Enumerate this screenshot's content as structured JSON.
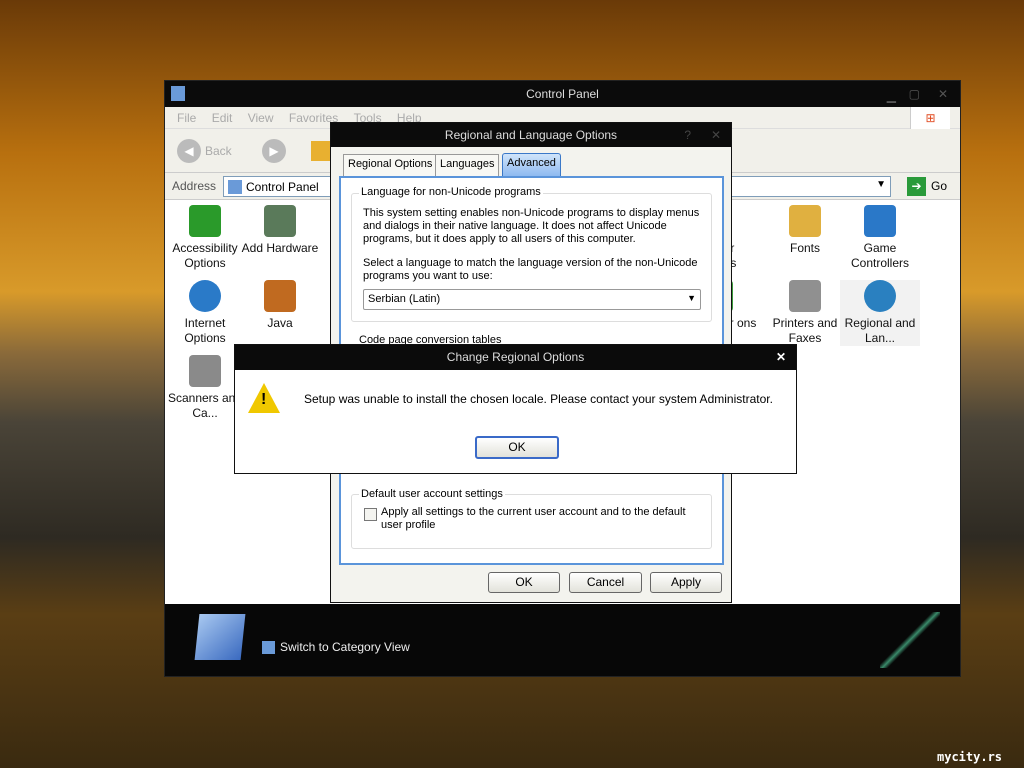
{
  "control_panel": {
    "title": "Control Panel",
    "menu": [
      "File",
      "Edit",
      "View",
      "Favorites",
      "Tools",
      "Help"
    ],
    "back_label": "Back",
    "address_label": "Address",
    "address_value": "Control Panel",
    "go_label": "Go",
    "icons": [
      {
        "label": "Accessibility Options",
        "color": "#2a9a2a"
      },
      {
        "label": "Add Hardware",
        "color": "#5a7a5a"
      },
      {
        "label": "Internet Options",
        "color": "#2a7ac8"
      },
      {
        "label": "Java",
        "color": "#c06a20"
      },
      {
        "label": "Scanners and Ca...",
        "color": "#8a8a8a"
      },
      {
        "label": "der ons",
        "color": "#6ac04a"
      },
      {
        "label": "Fonts",
        "color": "#e0b040"
      },
      {
        "label": "Game Controllers",
        "color": "#2a78c8"
      },
      {
        "label": "ver ons",
        "color": "#3a9a3a"
      },
      {
        "label": "Printers and Faxes",
        "color": "#909090"
      },
      {
        "label": "Regional and Lan...",
        "color": "#2a80c0"
      }
    ],
    "switch_view": "Switch to Category View"
  },
  "regional_dialog": {
    "title": "Regional and Language Options",
    "tabs": [
      "Regional Options",
      "Languages",
      "Advanced"
    ],
    "active_tab": "Advanced",
    "group1_title": "Language for non-Unicode programs",
    "group1_text": "This system setting enables non-Unicode programs to display menus and dialogs in their native language. It does not affect Unicode programs, but it does apply to all users of this computer.",
    "select_label": "Select a language to match the language version of the non-Unicode programs you want to use:",
    "selected_language": "Serbian (Latin)",
    "group2_title": "Code page conversion tables",
    "group3_title": "Default user account settings",
    "checkbox_label": "Apply all settings to the current user account and to the default user profile",
    "checkbox_checked": false,
    "ok": "OK",
    "cancel": "Cancel",
    "apply": "Apply"
  },
  "error_dialog": {
    "title": "Change Regional Options",
    "message": "Setup was unable to install the chosen locale.  Please contact your system Administrator.",
    "ok": "OK",
    "icon": "warning-icon"
  },
  "watermark": "mycity.rs"
}
